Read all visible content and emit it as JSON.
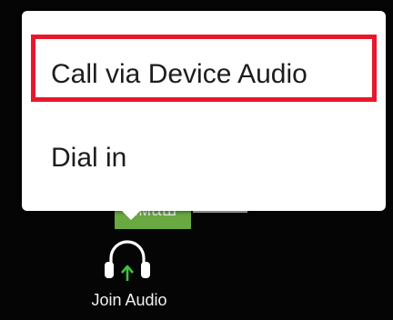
{
  "audio_menu": {
    "items": [
      {
        "label": "Call via Device Audio"
      },
      {
        "label": "Dial in"
      }
    ],
    "highlight_color": "#e8182c"
  },
  "toolbar": {
    "join_audio_label": "Join Audio",
    "join_audio_icon": "headphone-arrow-up-icon",
    "icon_arrow_color": "#3ec43e"
  },
  "background_label": {
    "text": "ммаш",
    "accent_color": "#6aa842"
  }
}
